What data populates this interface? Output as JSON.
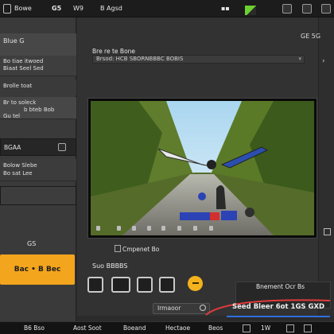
{
  "topbar": {
    "left_label": "Bowe",
    "app_code": "G5",
    "mode": "W9",
    "doc_title": "B Agsd"
  },
  "left_panel": {
    "header": "Blue G",
    "block1_line1": "Bo tiae itwoed",
    "block1_line2": "Biaat Seel Sed",
    "block1_line3": "Brolle toat",
    "block2_line1": "Br to soleck",
    "block2_line2": "b bteb Bob",
    "block2_line3": "Gu tel",
    "dark_label": "BGAA",
    "block3_line1": "Bolow Slebe",
    "block3_line2": "Bo sat Lee",
    "footer_label": "GS",
    "orange_button": "Bac • B Bec"
  },
  "main": {
    "right_label": "GE 5G",
    "field_label": "Bre re te Bone",
    "field_value": "Brsod: HCB SBORNBBBC BOBIS",
    "sub_label": "Cmpenet Bo",
    "section_label": "Suo BBBBS",
    "preset_label": "Bnement Ocr Bs",
    "record_input": "Irmaoor",
    "status_text": "Seed Bleer 6ot 1GS GXD"
  },
  "bottombar": {
    "item1": "B6 Bso",
    "item2": "Aost Soot",
    "item3": "Boeand",
    "item4": "Hectaoe",
    "item5": "Beos",
    "item6": "1W"
  },
  "colors": {
    "accent_orange": "#f3a51d",
    "accent_yellow": "#f4b21d",
    "status_red": "#e23b3b",
    "status_blue": "#2e6fe0",
    "flag_green": "#6cd02f"
  },
  "icons": [
    "square-icon",
    "flag-icon",
    "window-icon",
    "caret-down-icon",
    "shape-square-icon",
    "shape-monitor-icon",
    "record-icon"
  ]
}
